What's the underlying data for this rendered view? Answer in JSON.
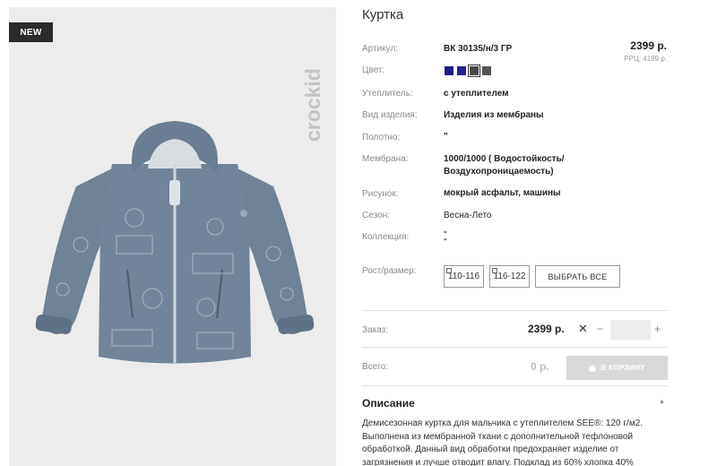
{
  "product": {
    "badge": "NEW",
    "brand_logo_text": "crockid",
    "title": "Куртка",
    "price": "2399 р.",
    "rrc": "РРЦ: 4199 р."
  },
  "specs": {
    "article_label": "Артикул:",
    "article_value": "ВК 30135/н/3 ГР",
    "color_label": "Цвет:",
    "insulation_label": "Утеплитель:",
    "insulation_value": "с утеплителем",
    "type_label": "Вид изделия:",
    "type_value": "Изделия из мембраны",
    "fabric_label": "Полотно:",
    "fabric_value": "\"",
    "membrane_label": "Мембрана:",
    "membrane_value_1": "1000/1000 ( Водостойкость/",
    "membrane_value_2": "Воздухопроницаемость)",
    "pattern_label": "Рисунок:",
    "pattern_value": "мокрый асфальт, машины",
    "season_label": "Сезон:",
    "season_value": "Весна-Лето",
    "collection_label": "Коллекция:",
    "collection_value_1": "\"",
    "collection_value_2": "\"",
    "size_label": "Рост/размер:"
  },
  "swatches": [
    {
      "name": "navy",
      "color": "#1d1d8c"
    },
    {
      "name": "navy-2",
      "color": "#22228f"
    },
    {
      "name": "grey-dark",
      "color": "#4a4a4a"
    },
    {
      "name": "grey",
      "color": "#555555"
    }
  ],
  "sizes": [
    {
      "label": "110-116"
    },
    {
      "label": "116-122"
    }
  ],
  "select_all_label": "ВЫБРАТЬ ВСЕ",
  "order": {
    "label": "Заказ:",
    "price": "2399 р.",
    "x": "✕",
    "minus": "–",
    "plus": "+",
    "qty": ""
  },
  "total": {
    "label": "Всего:",
    "value": "0 р.",
    "cart_button": "В КОРЗИНУ"
  },
  "description": {
    "title": "Описание",
    "toggle": "▲",
    "text": "Демисезонная куртка для мальчика с утеплителем SEE®: 120 г/м2. Выполнена из мембранной ткани с дополнительной тефлоновой обработкой. Данный вид обработки предохраняет изделие от загрязнения и лучше отводит влагу. Подклад из 60% хлопка 40%"
  },
  "colors": {
    "badge_bg": "#2b2b2b",
    "photo_bg": "#ececec",
    "jacket": "#6f8296",
    "cart_button_bg": "#d9d9d9"
  }
}
